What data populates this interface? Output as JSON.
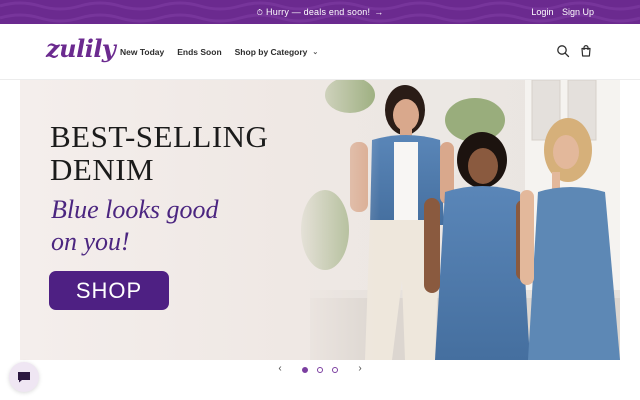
{
  "announcement": {
    "clock_icon": "clock-icon",
    "text": "Hurry — deals end soon!",
    "arrow": "→",
    "bg_color": "#6b2a8f"
  },
  "account": {
    "login": "Login",
    "signup": "Sign Up"
  },
  "header": {
    "logo": "zulily",
    "nav": [
      {
        "label": "New Today"
      },
      {
        "label": "Ends Soon"
      },
      {
        "label": "Shop by Category",
        "has_dropdown": true
      }
    ],
    "icons": [
      "search-icon",
      "cart-icon"
    ]
  },
  "hero": {
    "title_line1": "BEST-SELLING",
    "title_line2": "DENIM",
    "subtitle_line1": "Blue looks good",
    "subtitle_line2": "on you!",
    "cta": "SHOP",
    "accent_color": "#4e2083"
  },
  "slider": {
    "prev_icon": "chevron-left-icon",
    "next_icon": "chevron-right-icon",
    "prev": "‹",
    "next": "›",
    "slide_count": 3,
    "active_index": 0
  },
  "chat": {
    "icon": "chat-bubble-icon"
  }
}
